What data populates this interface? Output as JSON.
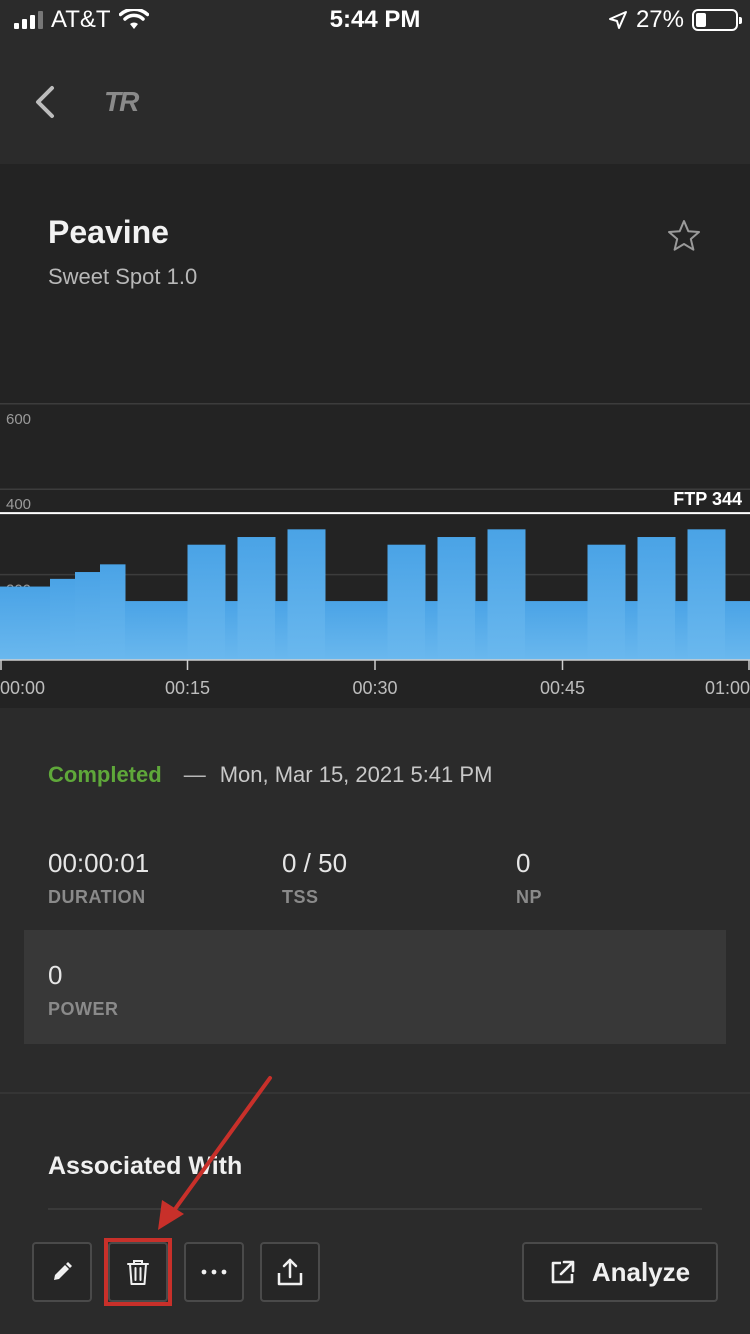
{
  "status_bar": {
    "carrier": "AT&T",
    "time": "5:44 PM",
    "battery_percent": "27%",
    "icons": [
      "signal-icon",
      "wifi-icon",
      "location-icon",
      "battery-icon"
    ]
  },
  "nav": {
    "back_icon": "chevron-left-icon",
    "logo_text": "TR"
  },
  "workout": {
    "title": "Peavine",
    "subtitle": "Sweet Spot 1.0",
    "favorite_icon": "star-outline-icon"
  },
  "chart_data": {
    "type": "bar",
    "y_ticks": [
      "600",
      "400",
      "200"
    ],
    "y_tick_values": [
      600,
      400,
      200
    ],
    "ylim": [
      0,
      740
    ],
    "x_ticks": [
      "00:00",
      "00:15",
      "00:30",
      "00:45",
      "01:00"
    ],
    "x_tick_minutes": [
      0,
      15,
      30,
      45,
      60
    ],
    "xlim_minutes": [
      0,
      60
    ],
    "ftp_label": "FTP 344",
    "ftp_value": 344,
    "intervals": [
      {
        "start": 0,
        "end": 4,
        "value": 172
      },
      {
        "start": 4,
        "end": 6,
        "value": 190
      },
      {
        "start": 6,
        "end": 8,
        "value": 206
      },
      {
        "start": 8,
        "end": 10,
        "value": 224
      },
      {
        "start": 10,
        "end": 15,
        "value": 138
      },
      {
        "start": 15,
        "end": 18,
        "value": 270
      },
      {
        "start": 18,
        "end": 19,
        "value": 138
      },
      {
        "start": 19,
        "end": 22,
        "value": 288
      },
      {
        "start": 22,
        "end": 23,
        "value": 138
      },
      {
        "start": 23,
        "end": 26,
        "value": 306
      },
      {
        "start": 26,
        "end": 31,
        "value": 138
      },
      {
        "start": 31,
        "end": 34,
        "value": 270
      },
      {
        "start": 34,
        "end": 35,
        "value": 138
      },
      {
        "start": 35,
        "end": 38,
        "value": 288
      },
      {
        "start": 38,
        "end": 39,
        "value": 138
      },
      {
        "start": 39,
        "end": 42,
        "value": 306
      },
      {
        "start": 42,
        "end": 47,
        "value": 138
      },
      {
        "start": 47,
        "end": 50,
        "value": 270
      },
      {
        "start": 50,
        "end": 51,
        "value": 138
      },
      {
        "start": 51,
        "end": 54,
        "value": 288
      },
      {
        "start": 54,
        "end": 55,
        "value": 138
      },
      {
        "start": 55,
        "end": 58,
        "value": 306
      },
      {
        "start": 58,
        "end": 60,
        "value": 138
      }
    ],
    "bar_color": "#4aa3e6",
    "grid": true
  },
  "summary": {
    "status": "Completed",
    "separator": "—",
    "date": "Mon, Mar 15, 2021 5:41 PM",
    "metrics": [
      {
        "label": "DURATION",
        "value": "00:00:01"
      },
      {
        "label": "TSS",
        "value": "0 / 50"
      },
      {
        "label": "NP",
        "value": "0"
      }
    ],
    "power": {
      "label": "POWER",
      "value": "0"
    },
    "associated_title": "Associated With"
  },
  "toolbar": {
    "edit_icon": "pencil-icon",
    "delete_icon": "trash-icon",
    "more_icon": "more-horizontal-icon",
    "share_icon": "share-icon",
    "analyze_icon": "external-link-icon",
    "analyze_label": "Analyze"
  },
  "colors": {
    "completed": "#5fa83a",
    "annotation": "#c8302a",
    "panel": "#232323",
    "background": "#2b2b2b"
  }
}
